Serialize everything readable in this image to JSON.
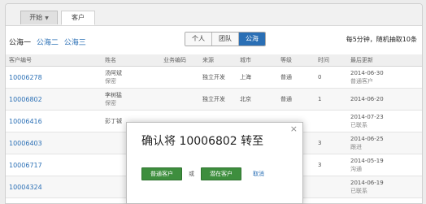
{
  "tabs": {
    "start": "开始",
    "customer": "客户"
  },
  "pools": {
    "active": "公海一",
    "links": [
      "公海二",
      "公海三"
    ]
  },
  "scope": {
    "options": [
      "个人",
      "团队",
      "公海"
    ],
    "selected": "公海"
  },
  "refresh_note": "每5分钟，随机抽取10条",
  "table": {
    "headers": [
      "客户编号",
      "姓名",
      "业务编码",
      "来源",
      "城市",
      "等级",
      "时间",
      "最后更新"
    ],
    "rows": [
      {
        "id": "10006278",
        "name": "汤阿斌",
        "name_sub": "保密",
        "code": "",
        "source": "独立开发",
        "city": "上海",
        "level": "普通",
        "time": "0",
        "update": "2014-06-30",
        "update_sub": "普通客户"
      },
      {
        "id": "10006802",
        "name": "李树猛",
        "name_sub": "保密",
        "code": "",
        "source": "独立开发",
        "city": "北京",
        "level": "普通",
        "time": "1",
        "update": "2014-06-20",
        "update_sub": ""
      },
      {
        "id": "10006416",
        "name": "彭丁铖",
        "name_sub": "",
        "code": "",
        "source": "",
        "city": "",
        "level": "",
        "time": "",
        "update": "2014-07-23",
        "update_sub": "已联系"
      },
      {
        "id": "10006403",
        "name": "",
        "name_sub": "",
        "code": "",
        "source": "",
        "city": "",
        "level": "",
        "time": "3",
        "update": "2014-06-25",
        "update_sub": "跟进"
      },
      {
        "id": "10006717",
        "name": "",
        "name_sub": "",
        "code": "",
        "source": "",
        "city": "",
        "level": "",
        "time": "3",
        "update": "2014-05-19",
        "update_sub": "沟通"
      },
      {
        "id": "10004324",
        "name": "",
        "name_sub": "",
        "code": "",
        "source": "",
        "city": "",
        "level": "",
        "time": "",
        "update": "2014-06-19",
        "update_sub": "已联系"
      }
    ]
  },
  "modal": {
    "title": "确认将 10006802 转至",
    "close": "×",
    "btn_normal": "普通客户",
    "or": "或",
    "btn_vip": "潜在客户",
    "cancel": "取消"
  }
}
